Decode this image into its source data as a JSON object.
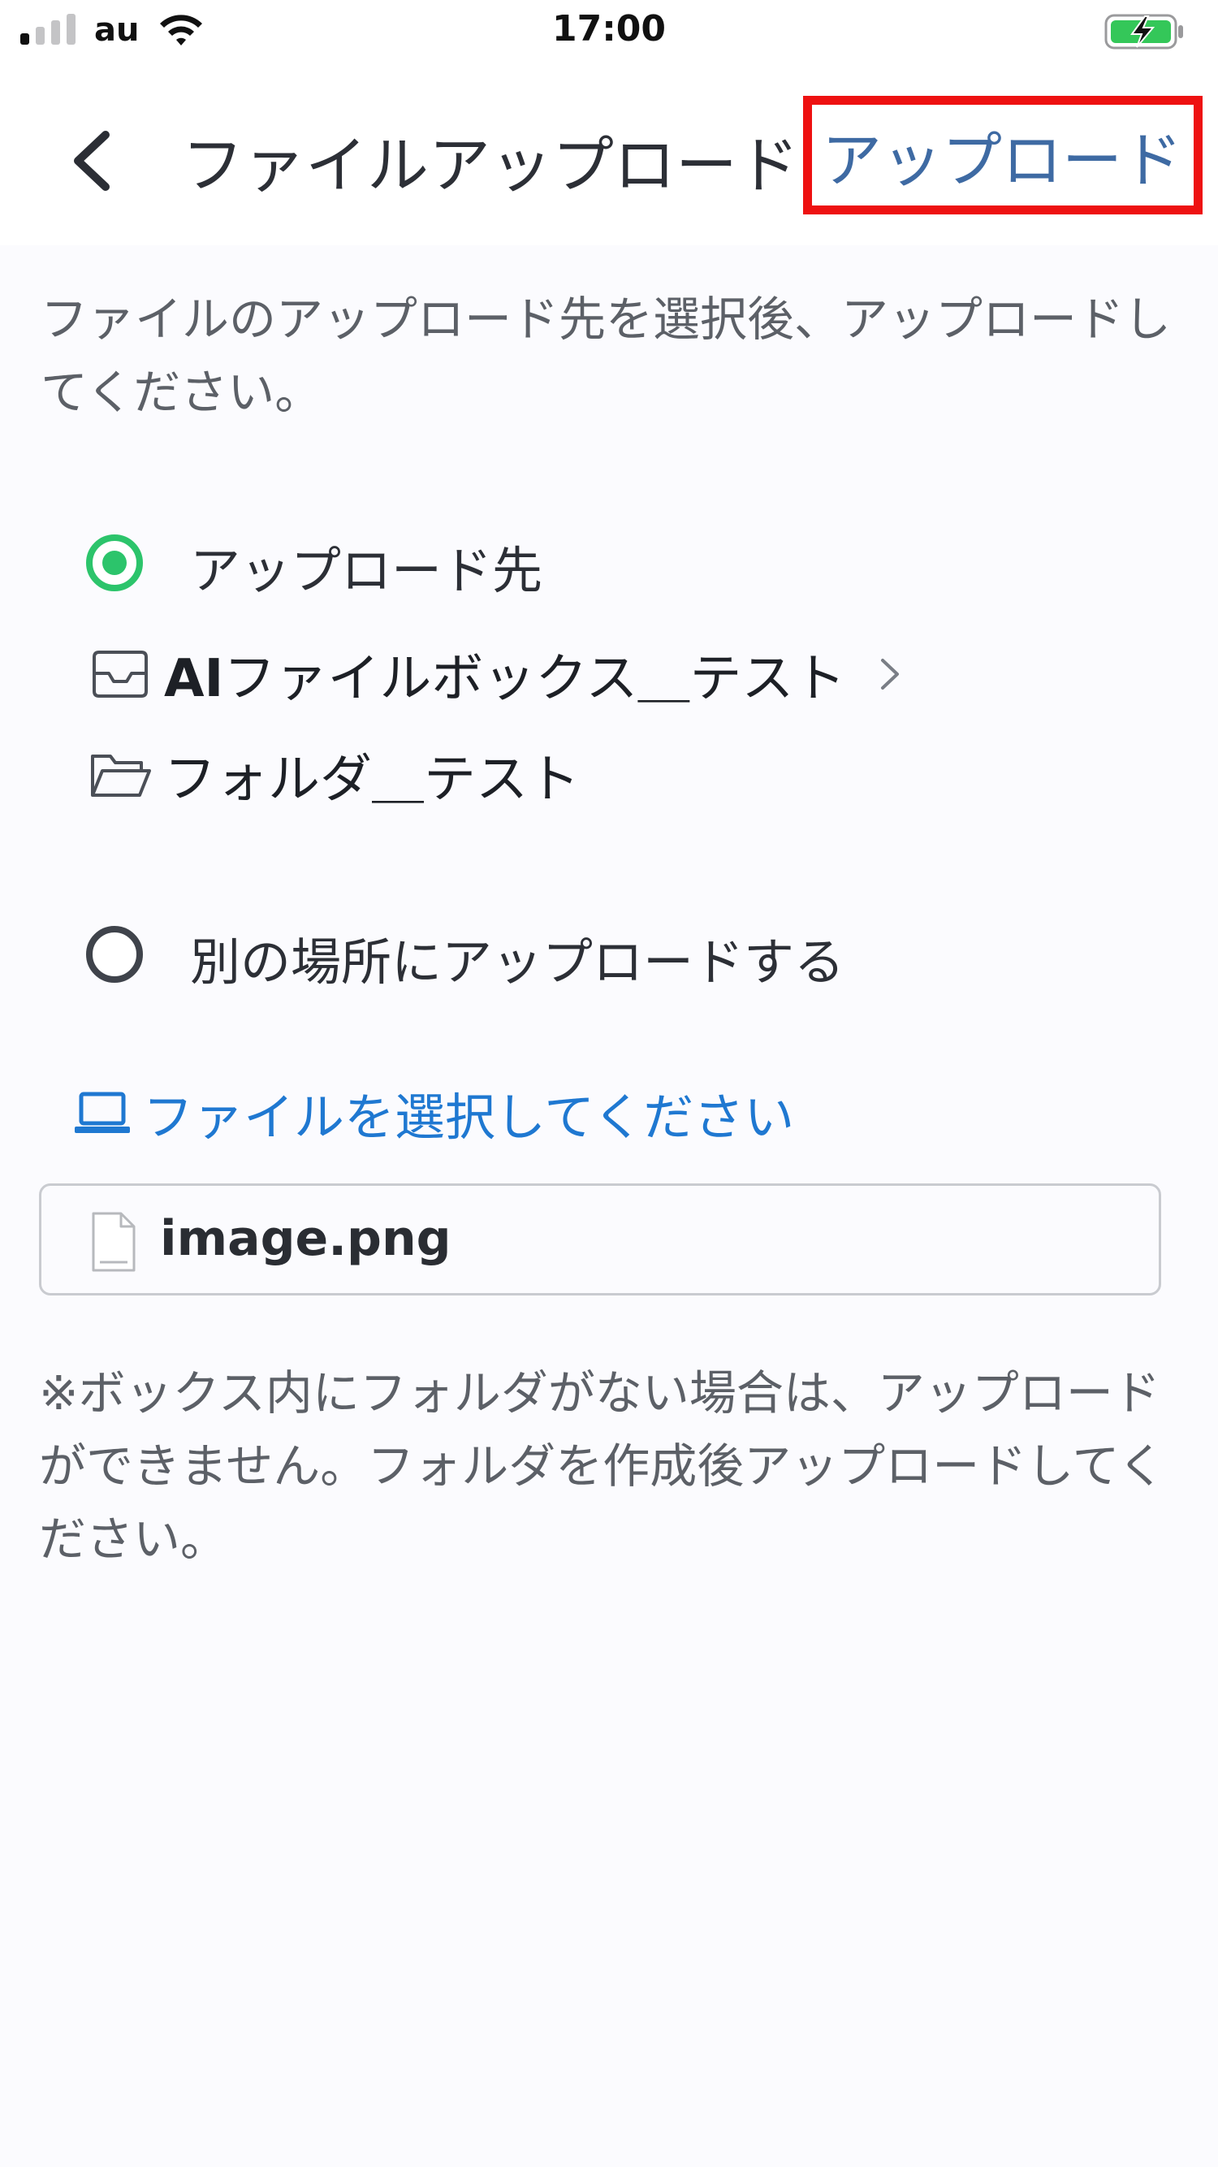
{
  "status_bar": {
    "carrier": "au",
    "time": "17:00",
    "icons": [
      "signal-icon",
      "wifi-icon",
      "battery-charging-icon"
    ]
  },
  "nav": {
    "back_icon": "chevron-left-icon",
    "title": "ファイルアップロード",
    "upload_label": "アップロード"
  },
  "instruction": "ファイルのアップロード先を選択後、アップロードしてください。",
  "options": {
    "destination_label": "アップロード先",
    "destination_selected": true,
    "box_prefix": "AI",
    "box_name": "ファイルボックス＿テスト",
    "folder_name": "フォルダ＿テスト",
    "other_location_label": "別の場所にアップロードする",
    "other_location_selected": false
  },
  "select_file": {
    "icon": "laptop-icon",
    "label": "ファイルを選択してください"
  },
  "selected_file": {
    "icon": "document-icon",
    "name": "image.png"
  },
  "note": "※ボックス内にフォルダがない場合は、アップロードができません。フォルダを作成後アップロードしてください。",
  "colors": {
    "accent_green": "#2cc46b",
    "link_blue": "#1f78d1",
    "nav_action_blue": "#3e6aa3",
    "highlight_red": "#ee1111",
    "battery_green": "#34c759"
  }
}
